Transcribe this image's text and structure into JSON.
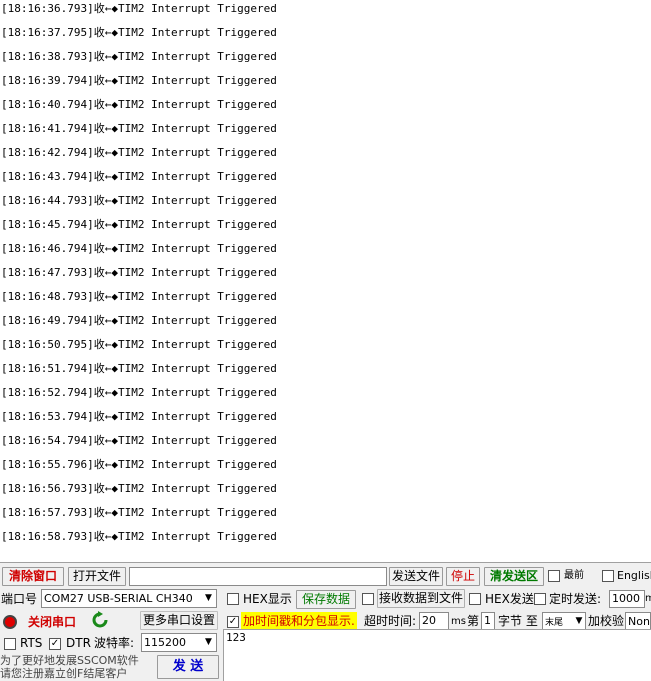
{
  "log": {
    "direction_glyph": "收←◆",
    "lines": [
      {
        "time": "[18:16:36.793]",
        "text": "TIM2 Interrupt Triggered"
      },
      {
        "time": "[18:16:37.795]",
        "text": "TIM2 Interrupt Triggered"
      },
      {
        "time": "[18:16:38.793]",
        "text": "TIM2 Interrupt Triggered"
      },
      {
        "time": "[18:16:39.794]",
        "text": "TIM2 Interrupt Triggered"
      },
      {
        "time": "[18:16:40.794]",
        "text": "TIM2 Interrupt Triggered"
      },
      {
        "time": "[18:16:41.794]",
        "text": "TIM2 Interrupt Triggered"
      },
      {
        "time": "[18:16:42.794]",
        "text": "TIM2 Interrupt Triggered"
      },
      {
        "time": "[18:16:43.794]",
        "text": "TIM2 Interrupt Triggered"
      },
      {
        "time": "[18:16:44.793]",
        "text": "TIM2 Interrupt Triggered"
      },
      {
        "time": "[18:16:45.794]",
        "text": "TIM2 Interrupt Triggered"
      },
      {
        "time": "[18:16:46.794]",
        "text": "TIM2 Interrupt Triggered"
      },
      {
        "time": "[18:16:47.793]",
        "text": "TIM2 Interrupt Triggered"
      },
      {
        "time": "[18:16:48.793]",
        "text": "TIM2 Interrupt Triggered"
      },
      {
        "time": "[18:16:49.794]",
        "text": "TIM2 Interrupt Triggered"
      },
      {
        "time": "[18:16:50.795]",
        "text": "TIM2 Interrupt Triggered"
      },
      {
        "time": "[18:16:51.794]",
        "text": "TIM2 Interrupt Triggered"
      },
      {
        "time": "[18:16:52.794]",
        "text": "TIM2 Interrupt Triggered"
      },
      {
        "time": "[18:16:53.794]",
        "text": "TIM2 Interrupt Triggered"
      },
      {
        "time": "[18:16:54.794]",
        "text": "TIM2 Interrupt Triggered"
      },
      {
        "time": "[18:16:55.796]",
        "text": "TIM2 Interrupt Triggered"
      },
      {
        "time": "[18:16:56.793]",
        "text": "TIM2 Interrupt Triggered"
      },
      {
        "time": "[18:16:57.793]",
        "text": "TIM2 Interrupt Triggered"
      },
      {
        "time": "[18:16:58.793]",
        "text": "TIM2 Interrupt Triggered"
      }
    ]
  },
  "toolbar": {
    "clear_window": "清除窗口",
    "open_file": "打开文件",
    "file_path": "",
    "send_file": "发送文件",
    "stop": "停止",
    "clear_send": "清发送区",
    "topmost": "最前",
    "english": "English"
  },
  "port": {
    "port_label": "端口号",
    "port_value": "COM27 USB-SERIAL CH340",
    "more_settings": "更多串口设置",
    "close_port": "关闭串口",
    "refresh_icon": "refresh-icon",
    "rts": "RTS",
    "dtr": "DTR",
    "dtr_checked": true,
    "baud_label": "波特率:",
    "baud_value": "115200",
    "promo_line1": "为了更好地发展SSCOM软件",
    "promo_line2": "请您注册嘉立创F结尾客户",
    "send_button": "发 送"
  },
  "options": {
    "hex_display": "HEX显示",
    "save_data": "保存数据",
    "receive_to_file": "接收数据到文件",
    "hex_send": "HEX发送",
    "timed_send": "定时发送:",
    "timed_value": "1000",
    "timed_unit": "m",
    "timestamp": "加时间戳和分包显示.",
    "timestamp_checked": true,
    "timeout_label": "超时时间:",
    "timeout_value": "20",
    "timeout_unit": "ms",
    "nth_label": "第",
    "nth_value": "1",
    "byte_label": "字节 至",
    "end_value": "末尾",
    "checksum_label": "加校验",
    "checksum_value": "None"
  },
  "send_text": "123",
  "colors": {
    "accent_red": "#d00000",
    "accent_green": "#007a00",
    "accent_blue": "#0000cc",
    "highlight_yellow": "#ffff00"
  }
}
